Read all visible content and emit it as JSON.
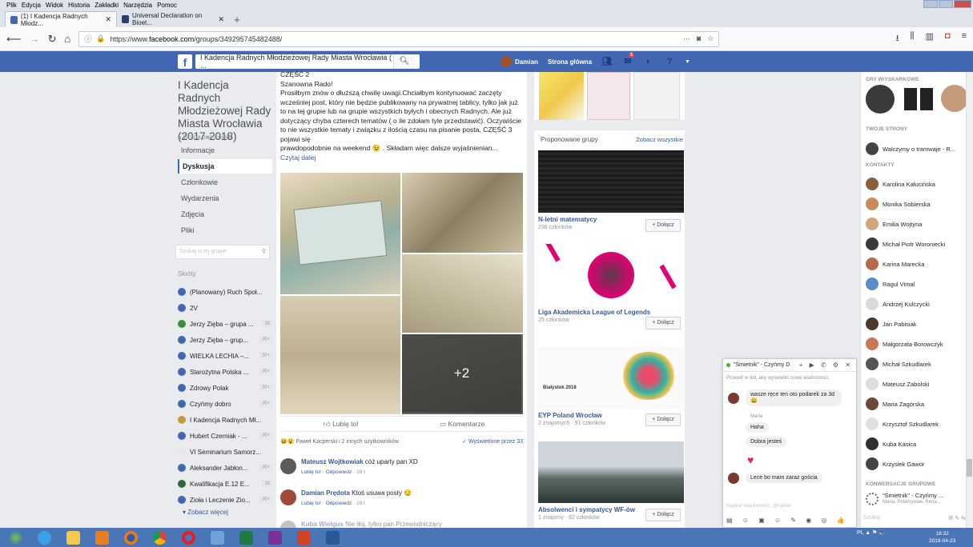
{
  "menubar": {
    "items": [
      "Plik",
      "Edycja",
      "Widok",
      "Historia",
      "Zakładki",
      "Narzędzia",
      "Pomoc"
    ]
  },
  "tabs": [
    {
      "label": "(1) I Kadencja Radnych Młodz..."
    },
    {
      "label": "Universal Declaration on Bioet..."
    }
  ],
  "navbar": {
    "url_prefix": "https://www.",
    "url_domain": "facebook.com",
    "url_path": "/groups/349295745482488/",
    "more": "···"
  },
  "fb": {
    "search_value": "I Kadencja Radnych Młodzieżowej Rady Miasta Wrocławia ( ...",
    "user_name": "Damian",
    "home_label": "Strona główna",
    "notif_count": "1"
  },
  "group": {
    "name": "I Kadencja Radnych Młodzieżowej Rady Miasta Wrocławia (2017-2018)",
    "closed_label": "Grupa zamknięta",
    "nav": [
      "Informacje",
      "Dyskusja",
      "Członkowie",
      "Wydarzenia",
      "Zdjęcia",
      "Pliki"
    ],
    "search_placeholder": "Szukaj w tej grupie",
    "shortcuts_title": "Skróty",
    "shortcuts": [
      {
        "label": "(Planowany) Ruch Społ...",
        "count": ""
      },
      {
        "label": "2V",
        "count": ""
      },
      {
        "label": "Jerzy Zięba – grupa ...",
        "count": "18"
      },
      {
        "label": "Jerzy Zięba – grup...",
        "count": "20+"
      },
      {
        "label": "WIELKA LECHIA –...",
        "count": "20+"
      },
      {
        "label": "Starożytna Polska ...",
        "count": "20+"
      },
      {
        "label": "Zdrowy Polak",
        "count": "20+"
      },
      {
        "label": "Czyńmy dobro",
        "count": "20+"
      },
      {
        "label": "I Kadencja Radnych Mł...",
        "count": ""
      },
      {
        "label": "Hubert Czerniak - ...",
        "count": "20+"
      },
      {
        "label": "VI Seminarium Samorz...",
        "count": ""
      },
      {
        "label": "Aleksander Jabłon...",
        "count": "20+"
      },
      {
        "label": "Kwalifikacja E.12 E...",
        "count": "18"
      },
      {
        "label": "Zioła i Leczenie Zio...",
        "count": "20+"
      }
    ],
    "see_more": "Zobacz więcej"
  },
  "post": {
    "lines": [
      "CZĘŚĆ 2",
      "Szanowna Rado!",
      "Prosiłbym znów o dłuższą chwilę uwagi.Chciałbym kontynuować zaczęty wcześniej post, który nie będzie publikowany na prywatnej tablicy, tylko jak już to na tej grupie lub na grupie wszystkich byłych i obecnych Radnych. Ale już dotyczący chyba czterech tematów ( o ile zdołam tyle przedstawić). Oczywiście to nie wszystkie tematy i związku z ilością czasu na pisanie posta, CZĘŚĆ 3 pojawi się",
      "prawdopodobnie na weekend 😉 . Składam więc dalsze wyjaśnienian..."
    ],
    "read_more": "Czytaj dalej",
    "photo_more": "+2",
    "like": "Lubię to!",
    "comment": "Komentarze",
    "reactions": "Paweł Kacperski i 2 innych użytkowników",
    "seen": "✓ Wyświetlone przez 33",
    "comments": [
      {
        "author": "Mateusz Wojtkowiak",
        "text": "cóż uparty pan XD",
        "like": "Lubię to!",
        "reply": "Odpowiedz",
        "time": "18 t"
      },
      {
        "author": "Damian Prędota",
        "text": "Ktoś usuwa posty 😏",
        "like": "Lubię to!",
        "reply": "Odpowiedz",
        "time": "18 t"
      },
      {
        "author": "Kuba Wielgus",
        "text": "Nie tłoj, tylko pan Przewodniczący"
      }
    ]
  },
  "proposed": {
    "title": "Proponowane grupy",
    "see_all": "Zobacz wszystkie",
    "join": "+ Dołącz",
    "groups": [
      {
        "name": "N-letni matematycy",
        "members": "236 członków"
      },
      {
        "name": "Liga Akademicka League of Legends",
        "members": "25 członków"
      },
      {
        "name": "EYP Poland Wrocław",
        "members": "2 znajomych · 91 członków"
      },
      {
        "name": "Absolwenci i sympatycy WF-ów",
        "members": "1 znajomy · 82 członków"
      }
    ],
    "eyp_banner": "Białystok 2018"
  },
  "chatside": {
    "top_label": "GRY W/YSKARKOWE",
    "pages_title": "TWOJE STRONY",
    "page": "Walczymy o tramwaje - R...",
    "contacts_title": "KONTAKTY",
    "contacts": [
      {
        "name": "Karolina Kałucińska",
        "color": "#8b5e3c"
      },
      {
        "name": "Monika Sobierska",
        "color": "#c98b5a"
      },
      {
        "name": "Emilia Wojtyna",
        "color": "#d2a57a"
      },
      {
        "name": "Michał Piotr Woroniecki",
        "color": "#3a3a3a"
      },
      {
        "name": "Karina Marecka",
        "color": "#b36b4b"
      },
      {
        "name": "Ragul Vimal",
        "color": "#5b8cc7"
      },
      {
        "name": "Andrzej Kulczycki",
        "color": "#d9d9d9"
      },
      {
        "name": "Jan Pabisiak",
        "color": "#4b3a2a"
      },
      {
        "name": "Małgorzata Borowczyk",
        "color": "#c47a5a"
      },
      {
        "name": "Michał Szkudlarek",
        "color": "#555555"
      },
      {
        "name": "Mateusz Zabolski",
        "color": "#dddddd"
      },
      {
        "name": "Maria Zagórska",
        "color": "#6b4a3a"
      },
      {
        "name": "Krzysztof Szkudlarek",
        "color": "#e0e0e0"
      },
      {
        "name": "Kuba Kasica",
        "color": "#2f2f2f"
      },
      {
        "name": "Krzysiek Gawor",
        "color": "#444444"
      }
    ],
    "conv_title": "KONWERSACJE GRUPOWE",
    "conv_name": "\"Śmietnik\" - Czyńmy ...",
    "conv_members": "Maria, Polamyslaw, Rena...",
    "search_placeholder": "Szukaj"
  },
  "chat": {
    "title": "\"Śmietnik\" - Czyńmy D",
    "note": "Przewiń w dół, aby wyświetlić nowe wiadomości.",
    "messages": [
      {
        "text": "wasze ręce ten oto podarek za 3d 😄"
      },
      {
        "name": "Marta",
        "text": "Haha"
      },
      {
        "text": "Dobra jesteś"
      },
      {
        "text": "Lece bo mam zaraz gościa"
      }
    ],
    "input_placeholder": "Napisz wiadomość, @name",
    "tools": "▤ ☺ ▣ ☺ ✎ ◉ ◎ 👍"
  },
  "taskbar": {
    "tray": "PL ▲ ⚑ 🔈",
    "time": "18:32",
    "date": "2018-04-23"
  },
  "colors": {
    "fb_blue": "#4267b2",
    "link": "#365899",
    "taskbar": "#4a76b8"
  }
}
